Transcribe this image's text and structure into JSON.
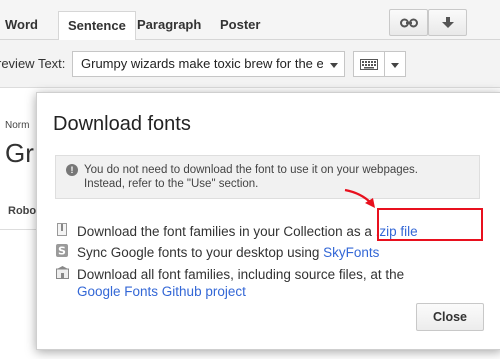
{
  "tabs": [
    "Word",
    "Sentence",
    "Paragraph",
    "Poster"
  ],
  "toolbar": {
    "link_icon": "link-icon",
    "download_icon": "download-arrow-icon"
  },
  "preview": {
    "label": "review Text:",
    "value": "Grumpy wizards make toxic brew for the e",
    "keyboard_icon": "keyboard-icon"
  },
  "background": {
    "normal_label": "Norm",
    "big_text": "Gr",
    "robot_label": "Robo"
  },
  "modal": {
    "title": "Download fonts",
    "notice_line1": "You do not need to download the font to use it on your webpages.",
    "notice_line2": "Instead, refer to the \"Use\" section.",
    "line1_text": "Download the font families in your Collection as a ",
    "line1_link": ".zip file",
    "line2_text": "Sync Google fonts to your desktop using ",
    "line2_link": "SkyFonts",
    "line3_text": "Download all font families, including source files, at the",
    "line3_link": "Google Fonts Github project",
    "close_label": "Close"
  },
  "colors": {
    "link": "#3367d6",
    "highlight": "#e8101e"
  }
}
